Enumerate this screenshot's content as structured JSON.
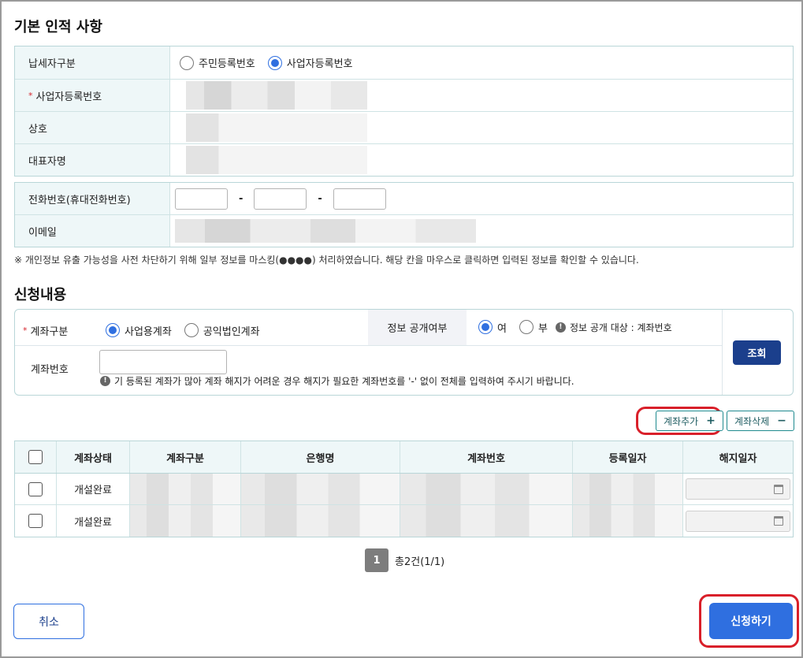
{
  "basic_info": {
    "title": "기본 인적 사항",
    "taxpayer_type_label": "납세자구분",
    "taxpayer_options": [
      {
        "label": "주민등록번호",
        "selected": false
      },
      {
        "label": "사업자등록번호",
        "selected": true
      }
    ],
    "required_mark": "*",
    "business_no_label": "사업자등록번호",
    "company_label": "상호",
    "ceo_label": "대표자명",
    "phone_label": "전화번호(휴대전화번호)",
    "phone_dash": "-",
    "email_label": "이메일"
  },
  "notice": "※ 개인정보 유출 가능성을 사전 차단하기 위해 일부 정보를 마스킹(●●●●) 처리하였습니다. 해당 칸을 마우스로 클릭하면 입력된 정보를 확인할 수 있습니다.",
  "apply": {
    "title": "신청내용",
    "account_type_label": "계좌구분",
    "account_type_options": [
      {
        "label": "사업용계좌",
        "selected": true
      },
      {
        "label": "공익법인계좌",
        "selected": false
      }
    ],
    "disclosure_label": "정보 공개여부",
    "disclosure_options": [
      {
        "label": "여",
        "selected": true
      },
      {
        "label": "부",
        "selected": false
      }
    ],
    "disclosure_info_icon": "!",
    "disclosure_info": "정보 공개 대상 : 계좌번호",
    "account_no_label": "계좌번호",
    "account_no_hint_icon": "!",
    "account_no_hint": "기 등록된 계좌가 많아 계좌 해지가 어려운 경우 해지가 필요한 계좌번호를 '-' 없이 전체를 입력하여 주시기 바랍니다.",
    "search_button": "조회"
  },
  "table_actions": {
    "add_label": "계좌추가",
    "add_symbol": "+",
    "delete_label": "계좌삭제",
    "delete_symbol": "−"
  },
  "account_table": {
    "headers": [
      "계좌상태",
      "계좌구분",
      "은행명",
      "계좌번호",
      "등록일자",
      "해지일자"
    ],
    "rows": [
      {
        "status": "개설완료"
      },
      {
        "status": "개설완료"
      }
    ]
  },
  "pagination": {
    "current_page": "1",
    "total_text": "총2건(1/1)"
  },
  "footer": {
    "cancel_label": "취소",
    "submit_label": "신청하기"
  },
  "colors": {
    "primary": "#2f6fe0",
    "dark_button": "#1b3f8c",
    "highlight_ring": "#d9202a",
    "table_header_bg": "#eef7f8"
  }
}
